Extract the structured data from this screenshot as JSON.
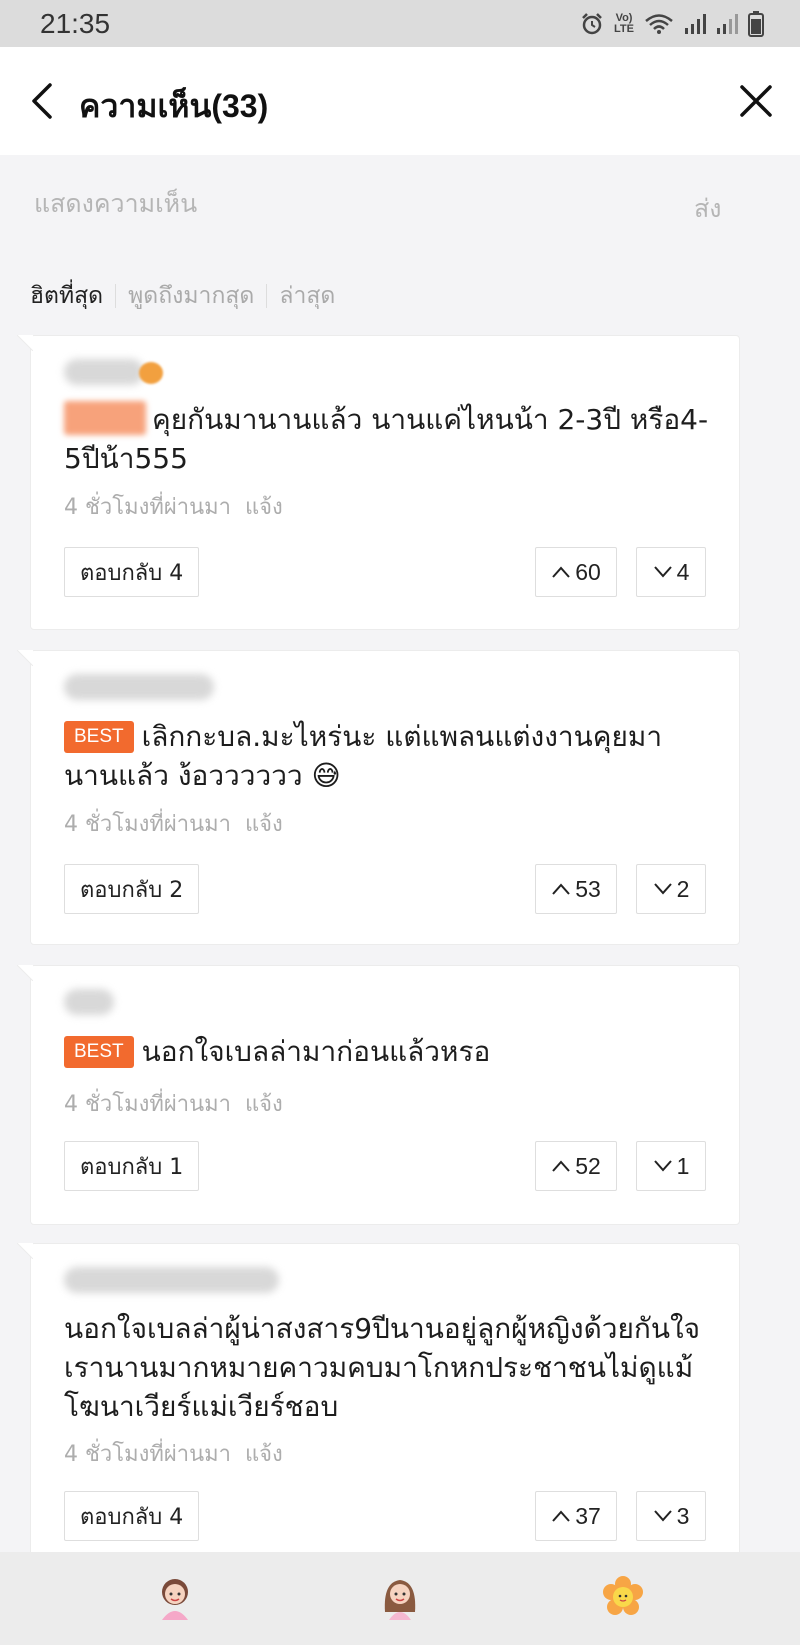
{
  "status_bar": {
    "time": "21:35",
    "volte_line1": "Vo)",
    "volte_line2": "LTE",
    "icons": [
      "alarm-icon",
      "volte-icon",
      "wifi-icon",
      "signal-icon",
      "signal-icon",
      "battery-icon"
    ]
  },
  "header": {
    "title": "ความเห็น(33)",
    "back_icon": "chevron-left-icon",
    "close_icon": "close-icon"
  },
  "comment_box": {
    "placeholder": "แสดงความเห็น",
    "send_label": "ส่ง"
  },
  "sort_tabs": [
    {
      "label": "ฮิตที่สุด",
      "active": true
    },
    {
      "label": "พูดถึงมากสุด",
      "active": false
    },
    {
      "label": "ล่าสุด",
      "active": false
    }
  ],
  "comments": [
    {
      "badge": "",
      "text": "คุยกันมานานแล้ว นานแค่ไหนน้า 2-3ปี หรือ4-5ปีน้า555",
      "time": "4 ชั่วโมงที่ผ่านมา",
      "report": "แจ้ง",
      "reply_label": "ตอบกลับ 4",
      "upvotes": "60",
      "downvotes": "4"
    },
    {
      "badge": "BEST",
      "text": "เลิกกะบล.มะไหร่นะ แต่แพลนแต่งงานคุยมานานแล้ว ง้อวววววว 😅",
      "time": "4 ชั่วโมงที่ผ่านมา",
      "report": "แจ้ง",
      "reply_label": "ตอบกลับ 2",
      "upvotes": "53",
      "downvotes": "2"
    },
    {
      "badge": "BEST",
      "text": "นอกใจเบลล่ามาก่อนแล้วหรอ",
      "time": "4 ชั่วโมงที่ผ่านมา",
      "report": "แจ้ง",
      "reply_label": "ตอบกลับ 1",
      "upvotes": "52",
      "downvotes": "1"
    },
    {
      "badge": "",
      "text": "นอกใจเบลล่าผู้น่าสงสาร9ปีนานอยู่ลูกผู้หญิงด้วยกันใจเรานานมากหมายคาวมคบมาโกหกประชาชนไม่ดูแม้โฆนาเวียร์แม่เวียร์ชอบ",
      "time": "4 ชั่วโมงที่ผ่านมา",
      "report": "แจ้ง",
      "reply_label": "ตอบกลับ 4",
      "upvotes": "37",
      "downvotes": "3"
    }
  ],
  "bottom_bar": {
    "stickers": [
      "girl-sticker-icon",
      "girl-long-hair-sticker-icon",
      "flower-sticker-icon"
    ]
  },
  "colors": {
    "best_badge": "#f26a2e",
    "muted_text": "#adadad",
    "background": "#f4f4f6"
  }
}
